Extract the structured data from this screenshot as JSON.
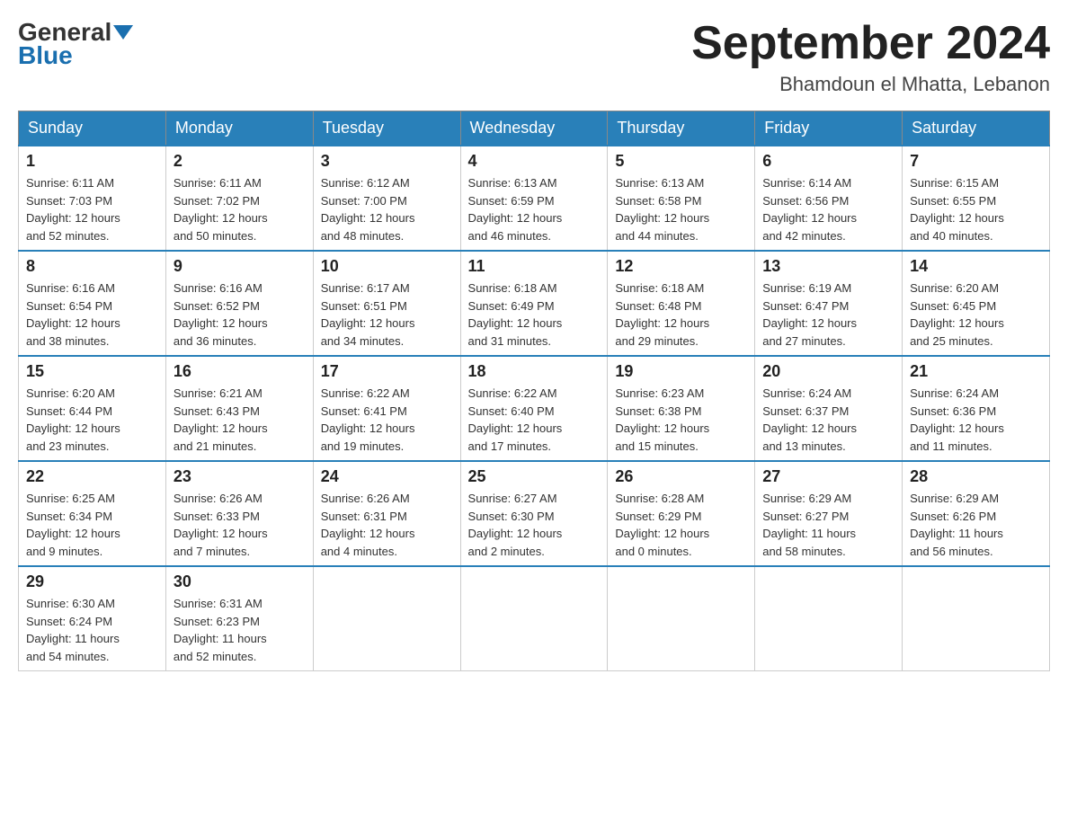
{
  "logo": {
    "general": "General",
    "blue": "Blue"
  },
  "title": "September 2024",
  "location": "Bhamdoun el Mhatta, Lebanon",
  "days_of_week": [
    "Sunday",
    "Monday",
    "Tuesday",
    "Wednesday",
    "Thursday",
    "Friday",
    "Saturday"
  ],
  "weeks": [
    [
      {
        "day": "1",
        "sunrise": "6:11 AM",
        "sunset": "7:03 PM",
        "daylight": "12 hours and 52 minutes."
      },
      {
        "day": "2",
        "sunrise": "6:11 AM",
        "sunset": "7:02 PM",
        "daylight": "12 hours and 50 minutes."
      },
      {
        "day": "3",
        "sunrise": "6:12 AM",
        "sunset": "7:00 PM",
        "daylight": "12 hours and 48 minutes."
      },
      {
        "day": "4",
        "sunrise": "6:13 AM",
        "sunset": "6:59 PM",
        "daylight": "12 hours and 46 minutes."
      },
      {
        "day": "5",
        "sunrise": "6:13 AM",
        "sunset": "6:58 PM",
        "daylight": "12 hours and 44 minutes."
      },
      {
        "day": "6",
        "sunrise": "6:14 AM",
        "sunset": "6:56 PM",
        "daylight": "12 hours and 42 minutes."
      },
      {
        "day": "7",
        "sunrise": "6:15 AM",
        "sunset": "6:55 PM",
        "daylight": "12 hours and 40 minutes."
      }
    ],
    [
      {
        "day": "8",
        "sunrise": "6:16 AM",
        "sunset": "6:54 PM",
        "daylight": "12 hours and 38 minutes."
      },
      {
        "day": "9",
        "sunrise": "6:16 AM",
        "sunset": "6:52 PM",
        "daylight": "12 hours and 36 minutes."
      },
      {
        "day": "10",
        "sunrise": "6:17 AM",
        "sunset": "6:51 PM",
        "daylight": "12 hours and 34 minutes."
      },
      {
        "day": "11",
        "sunrise": "6:18 AM",
        "sunset": "6:49 PM",
        "daylight": "12 hours and 31 minutes."
      },
      {
        "day": "12",
        "sunrise": "6:18 AM",
        "sunset": "6:48 PM",
        "daylight": "12 hours and 29 minutes."
      },
      {
        "day": "13",
        "sunrise": "6:19 AM",
        "sunset": "6:47 PM",
        "daylight": "12 hours and 27 minutes."
      },
      {
        "day": "14",
        "sunrise": "6:20 AM",
        "sunset": "6:45 PM",
        "daylight": "12 hours and 25 minutes."
      }
    ],
    [
      {
        "day": "15",
        "sunrise": "6:20 AM",
        "sunset": "6:44 PM",
        "daylight": "12 hours and 23 minutes."
      },
      {
        "day": "16",
        "sunrise": "6:21 AM",
        "sunset": "6:43 PM",
        "daylight": "12 hours and 21 minutes."
      },
      {
        "day": "17",
        "sunrise": "6:22 AM",
        "sunset": "6:41 PM",
        "daylight": "12 hours and 19 minutes."
      },
      {
        "day": "18",
        "sunrise": "6:22 AM",
        "sunset": "6:40 PM",
        "daylight": "12 hours and 17 minutes."
      },
      {
        "day": "19",
        "sunrise": "6:23 AM",
        "sunset": "6:38 PM",
        "daylight": "12 hours and 15 minutes."
      },
      {
        "day": "20",
        "sunrise": "6:24 AM",
        "sunset": "6:37 PM",
        "daylight": "12 hours and 13 minutes."
      },
      {
        "day": "21",
        "sunrise": "6:24 AM",
        "sunset": "6:36 PM",
        "daylight": "12 hours and 11 minutes."
      }
    ],
    [
      {
        "day": "22",
        "sunrise": "6:25 AM",
        "sunset": "6:34 PM",
        "daylight": "12 hours and 9 minutes."
      },
      {
        "day": "23",
        "sunrise": "6:26 AM",
        "sunset": "6:33 PM",
        "daylight": "12 hours and 7 minutes."
      },
      {
        "day": "24",
        "sunrise": "6:26 AM",
        "sunset": "6:31 PM",
        "daylight": "12 hours and 4 minutes."
      },
      {
        "day": "25",
        "sunrise": "6:27 AM",
        "sunset": "6:30 PM",
        "daylight": "12 hours and 2 minutes."
      },
      {
        "day": "26",
        "sunrise": "6:28 AM",
        "sunset": "6:29 PM",
        "daylight": "12 hours and 0 minutes."
      },
      {
        "day": "27",
        "sunrise": "6:29 AM",
        "sunset": "6:27 PM",
        "daylight": "11 hours and 58 minutes."
      },
      {
        "day": "28",
        "sunrise": "6:29 AM",
        "sunset": "6:26 PM",
        "daylight": "11 hours and 56 minutes."
      }
    ],
    [
      {
        "day": "29",
        "sunrise": "6:30 AM",
        "sunset": "6:24 PM",
        "daylight": "11 hours and 54 minutes."
      },
      {
        "day": "30",
        "sunrise": "6:31 AM",
        "sunset": "6:23 PM",
        "daylight": "11 hours and 52 minutes."
      },
      null,
      null,
      null,
      null,
      null
    ]
  ]
}
